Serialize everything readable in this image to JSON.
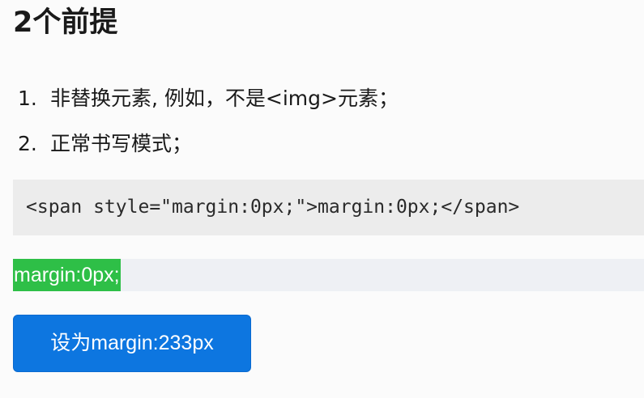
{
  "heading": "2个前提",
  "list": [
    {
      "number": "1.",
      "text": "非替换元素, 例如，不是<img>元素；"
    },
    {
      "number": "2.",
      "text": "正常书写模式；"
    }
  ],
  "code": "<span style=\"margin:0px;\">margin:0px;</span>",
  "demo_span_text": "margin:0px;",
  "button_label": "设为margin:233px",
  "colors": {
    "demo_span_bg": "#2ebf47",
    "button_bg": "#0d76e0",
    "code_bg": "#ececec"
  }
}
